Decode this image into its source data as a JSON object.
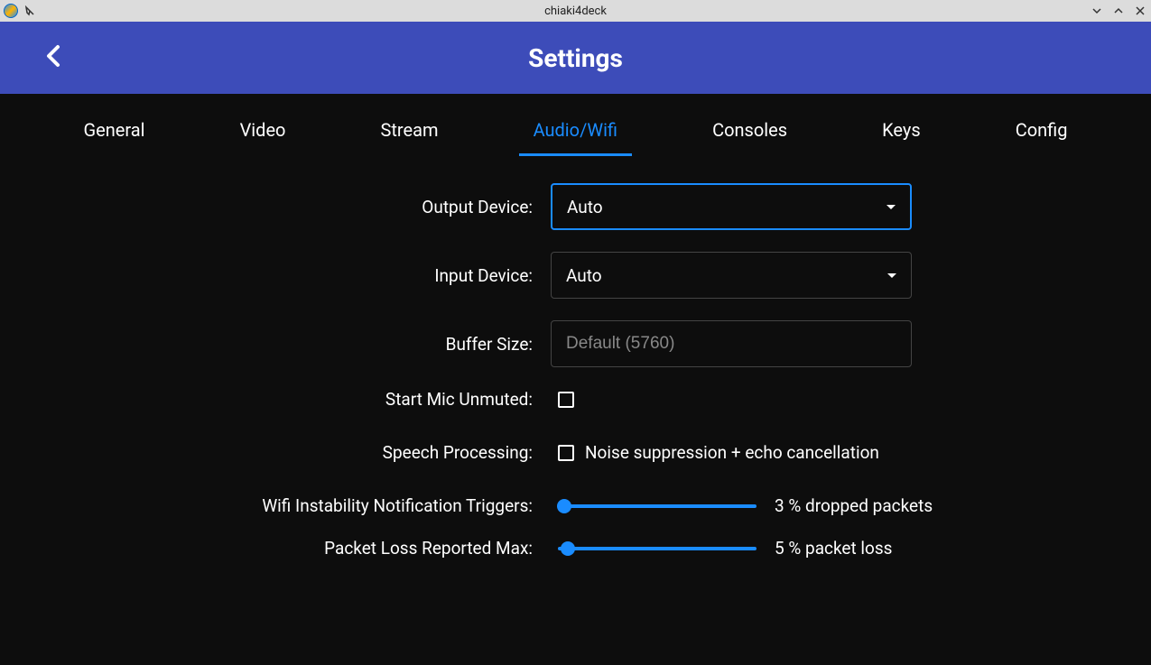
{
  "window": {
    "title": "chiaki4deck"
  },
  "header": {
    "title": "Settings"
  },
  "tabs": [
    {
      "label": "General",
      "active": false
    },
    {
      "label": "Video",
      "active": false
    },
    {
      "label": "Stream",
      "active": false
    },
    {
      "label": "Audio/Wifi",
      "active": true
    },
    {
      "label": "Consoles",
      "active": false
    },
    {
      "label": "Keys",
      "active": false
    },
    {
      "label": "Config",
      "active": false
    }
  ],
  "form": {
    "outputDevice": {
      "label": "Output Device:",
      "value": "Auto"
    },
    "inputDevice": {
      "label": "Input Device:",
      "value": "Auto"
    },
    "bufferSize": {
      "label": "Buffer Size:",
      "placeholder": "Default (5760)",
      "value": ""
    },
    "startMicUnmuted": {
      "label": "Start Mic Unmuted:",
      "checked": false
    },
    "speechProcessing": {
      "label": "Speech Processing:",
      "optionLabel": "Noise suppression + echo cancellation",
      "checked": false
    },
    "wifiInstability": {
      "label": "Wifi Instability Notification Triggers:",
      "valueText": "3 % dropped packets",
      "sliderPercent": 3
    },
    "packetLoss": {
      "label": "Packet Loss Reported Max:",
      "valueText": "5 % packet loss",
      "sliderPercent": 5
    }
  }
}
